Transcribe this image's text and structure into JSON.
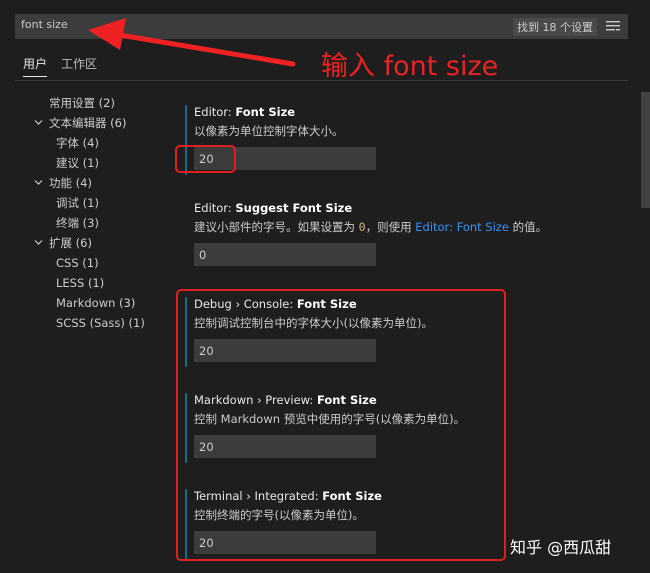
{
  "search": {
    "value": "font size",
    "result_count": "找到 18 个设置"
  },
  "tabs": [
    {
      "label": "用户"
    },
    {
      "label": "工作区"
    }
  ],
  "toc": [
    {
      "label": "常用设置",
      "count": "(2)"
    },
    {
      "label": "文本编辑器",
      "count": "(6)"
    },
    {
      "label": "字体",
      "count": "(4)"
    },
    {
      "label": "建议",
      "count": "(1)"
    },
    {
      "label": "功能",
      "count": "(4)"
    },
    {
      "label": "调试",
      "count": "(1)"
    },
    {
      "label": "终端",
      "count": "(3)"
    },
    {
      "label": "扩展",
      "count": "(6)"
    },
    {
      "label": "CSS",
      "count": "(1)"
    },
    {
      "label": "LESS",
      "count": "(1)"
    },
    {
      "label": "Markdown",
      "count": "(3)"
    },
    {
      "label": "SCSS (Sass)",
      "count": "(1)"
    }
  ],
  "settings": [
    {
      "category": "Editor: ",
      "name": "Font Size",
      "description": "以像素为单位控制字体大小。",
      "value": "20"
    },
    {
      "category": "Editor: ",
      "name": "Suggest Font Size",
      "desc_before": "建议小部件的字号。如果设置为 ",
      "desc_code": "0",
      "desc_mid": "，则使用 ",
      "desc_link": "Editor: Font Size",
      "desc_after": " 的值。",
      "value": "0"
    },
    {
      "category": "Debug › Console: ",
      "name": "Font Size",
      "description": "控制调试控制台中的字体大小(以像素为单位)。",
      "value": "20"
    },
    {
      "category": "Markdown › Preview: ",
      "name": "Font Size",
      "description": "控制 Markdown 预览中使用的字号(以像素为单位)。",
      "value": "20"
    },
    {
      "category": "Terminal › Integrated: ",
      "name": "Font Size",
      "description": "控制终端的字号(以像素为单位)。",
      "value": "20"
    }
  ],
  "annotation": {
    "text": "输入  font size"
  },
  "watermark": {
    "text": "知乎 @西瓜甜"
  },
  "colors": {
    "annotation_red": "#e02020",
    "link_blue": "#3794ff",
    "modified_bar": "#0b6e99"
  }
}
